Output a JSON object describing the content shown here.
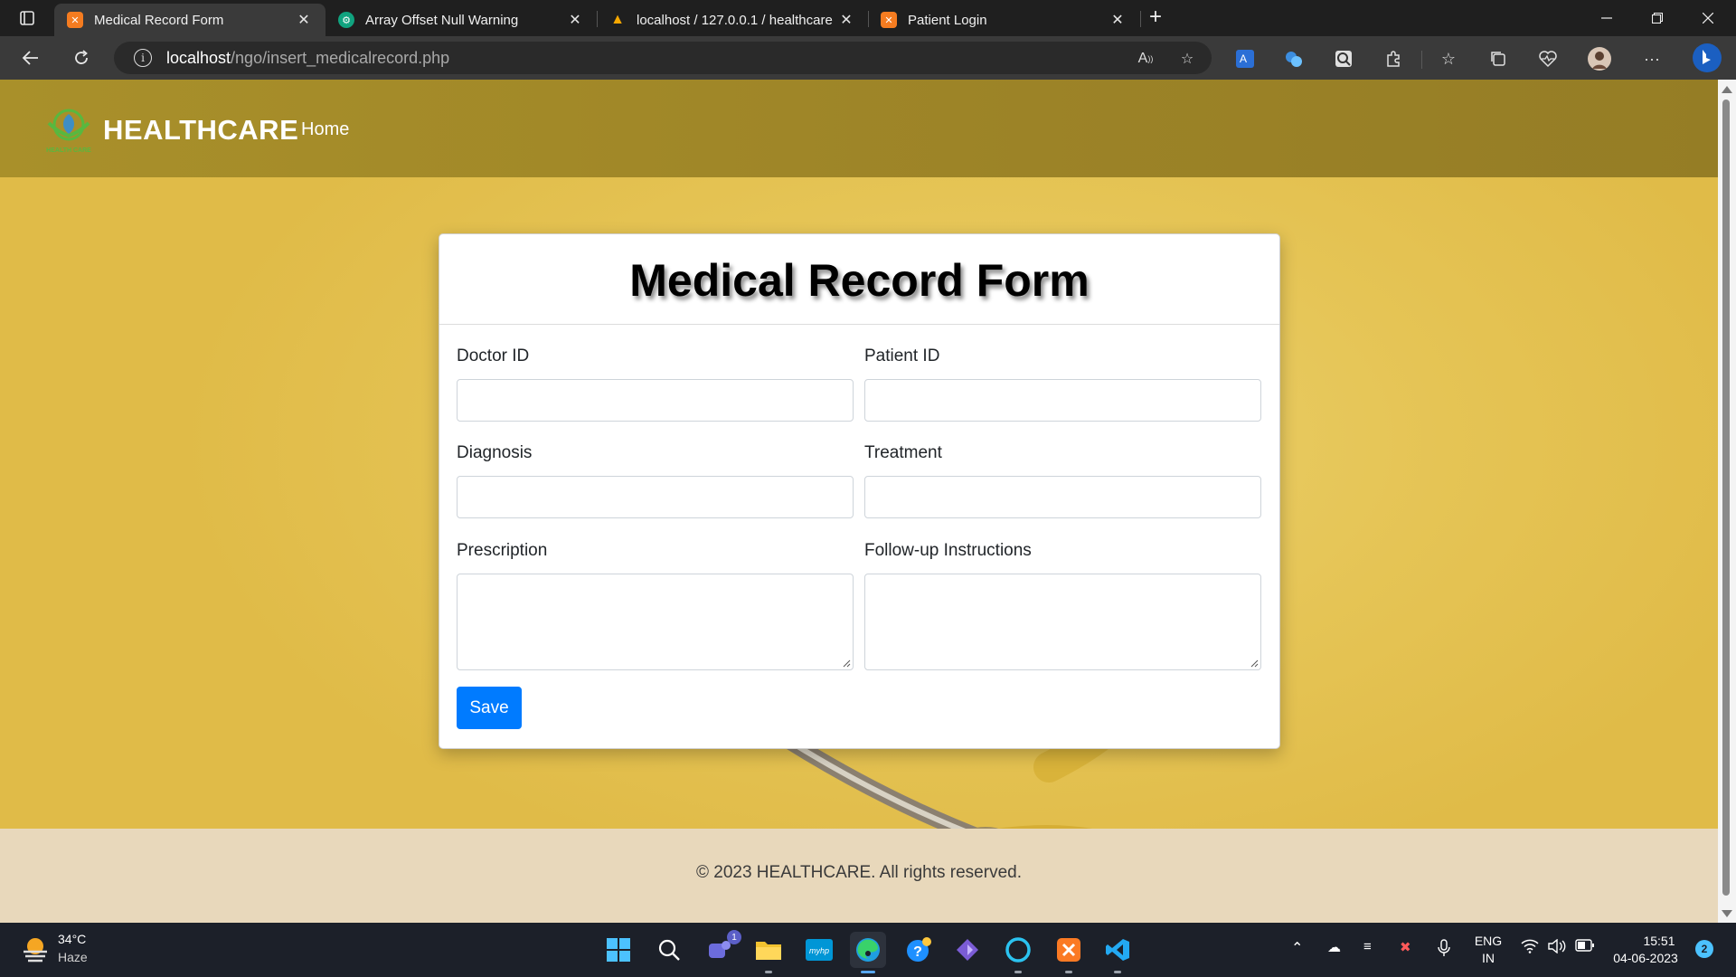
{
  "browser": {
    "tabs": [
      {
        "title": "Medical Record Form",
        "active": true
      },
      {
        "title": "Array Offset Null Warning",
        "active": false
      },
      {
        "title": "localhost / 127.0.0.1 / healthcare",
        "active": false
      },
      {
        "title": "Patient Login",
        "active": false
      }
    ],
    "url_host": "localhost",
    "url_path": "/ngo/insert_medicalrecord.php"
  },
  "site": {
    "brand": "HEALTHCARE",
    "logo_text": "HEALTH CARE",
    "nav_home": "Home",
    "footer": "© 2023 HEALTHCARE. All rights reserved."
  },
  "form": {
    "title": "Medical Record Form",
    "fields": {
      "doctor_id": {
        "label": "Doctor ID",
        "value": ""
      },
      "patient_id": {
        "label": "Patient ID",
        "value": ""
      },
      "diagnosis": {
        "label": "Diagnosis",
        "value": ""
      },
      "treatment": {
        "label": "Treatment",
        "value": ""
      },
      "prescription": {
        "label": "Prescription",
        "value": ""
      },
      "followup": {
        "label": "Follow-up Instructions",
        "value": ""
      }
    },
    "save_label": "Save"
  },
  "taskbar": {
    "weather_temp": "34°C",
    "weather_desc": "Haze",
    "teams_badge": "1",
    "lang_line1": "ENG",
    "lang_line2": "IN",
    "time": "15:51",
    "date": "04-06-2023",
    "notifications": "2"
  },
  "colors": {
    "accent": "#007bff",
    "nav_bg": "#9c8327",
    "page_bg": "#e2be4d",
    "footer_bg": "#e8d8bb"
  }
}
